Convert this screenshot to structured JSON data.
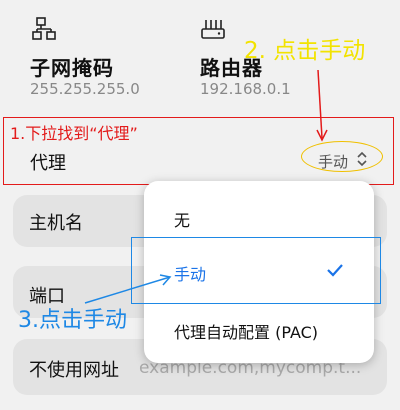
{
  "network": {
    "subnet": {
      "icon": "network-tree-icon",
      "title": "子网掩码",
      "value": "255.255.255.0"
    },
    "router": {
      "icon": "router-icon",
      "title": "路由器",
      "value": "192.168.0.1"
    }
  },
  "annotations": {
    "step1": "1.下拉找到“代理”",
    "step2": "2. 点击手动",
    "step3": "3.点击手动"
  },
  "proxy": {
    "label": "代理",
    "value": "手动",
    "chevron": "⌃⌄"
  },
  "fields": {
    "hostname": {
      "label": "主机名"
    },
    "port": {
      "label": "端口"
    },
    "bypass": {
      "label": "不使用网址",
      "placeholder": "example.com,mycomp.t..."
    }
  },
  "proxy_menu": {
    "options": [
      "无",
      "手动",
      "代理自动配置 (PAC)"
    ],
    "selected_index": 1
  },
  "colors": {
    "accent": "#1a73e8",
    "annotation_yellow": "#f2e300",
    "annotation_red": "#e31b1b",
    "annotation_blue": "#1e88e5"
  }
}
